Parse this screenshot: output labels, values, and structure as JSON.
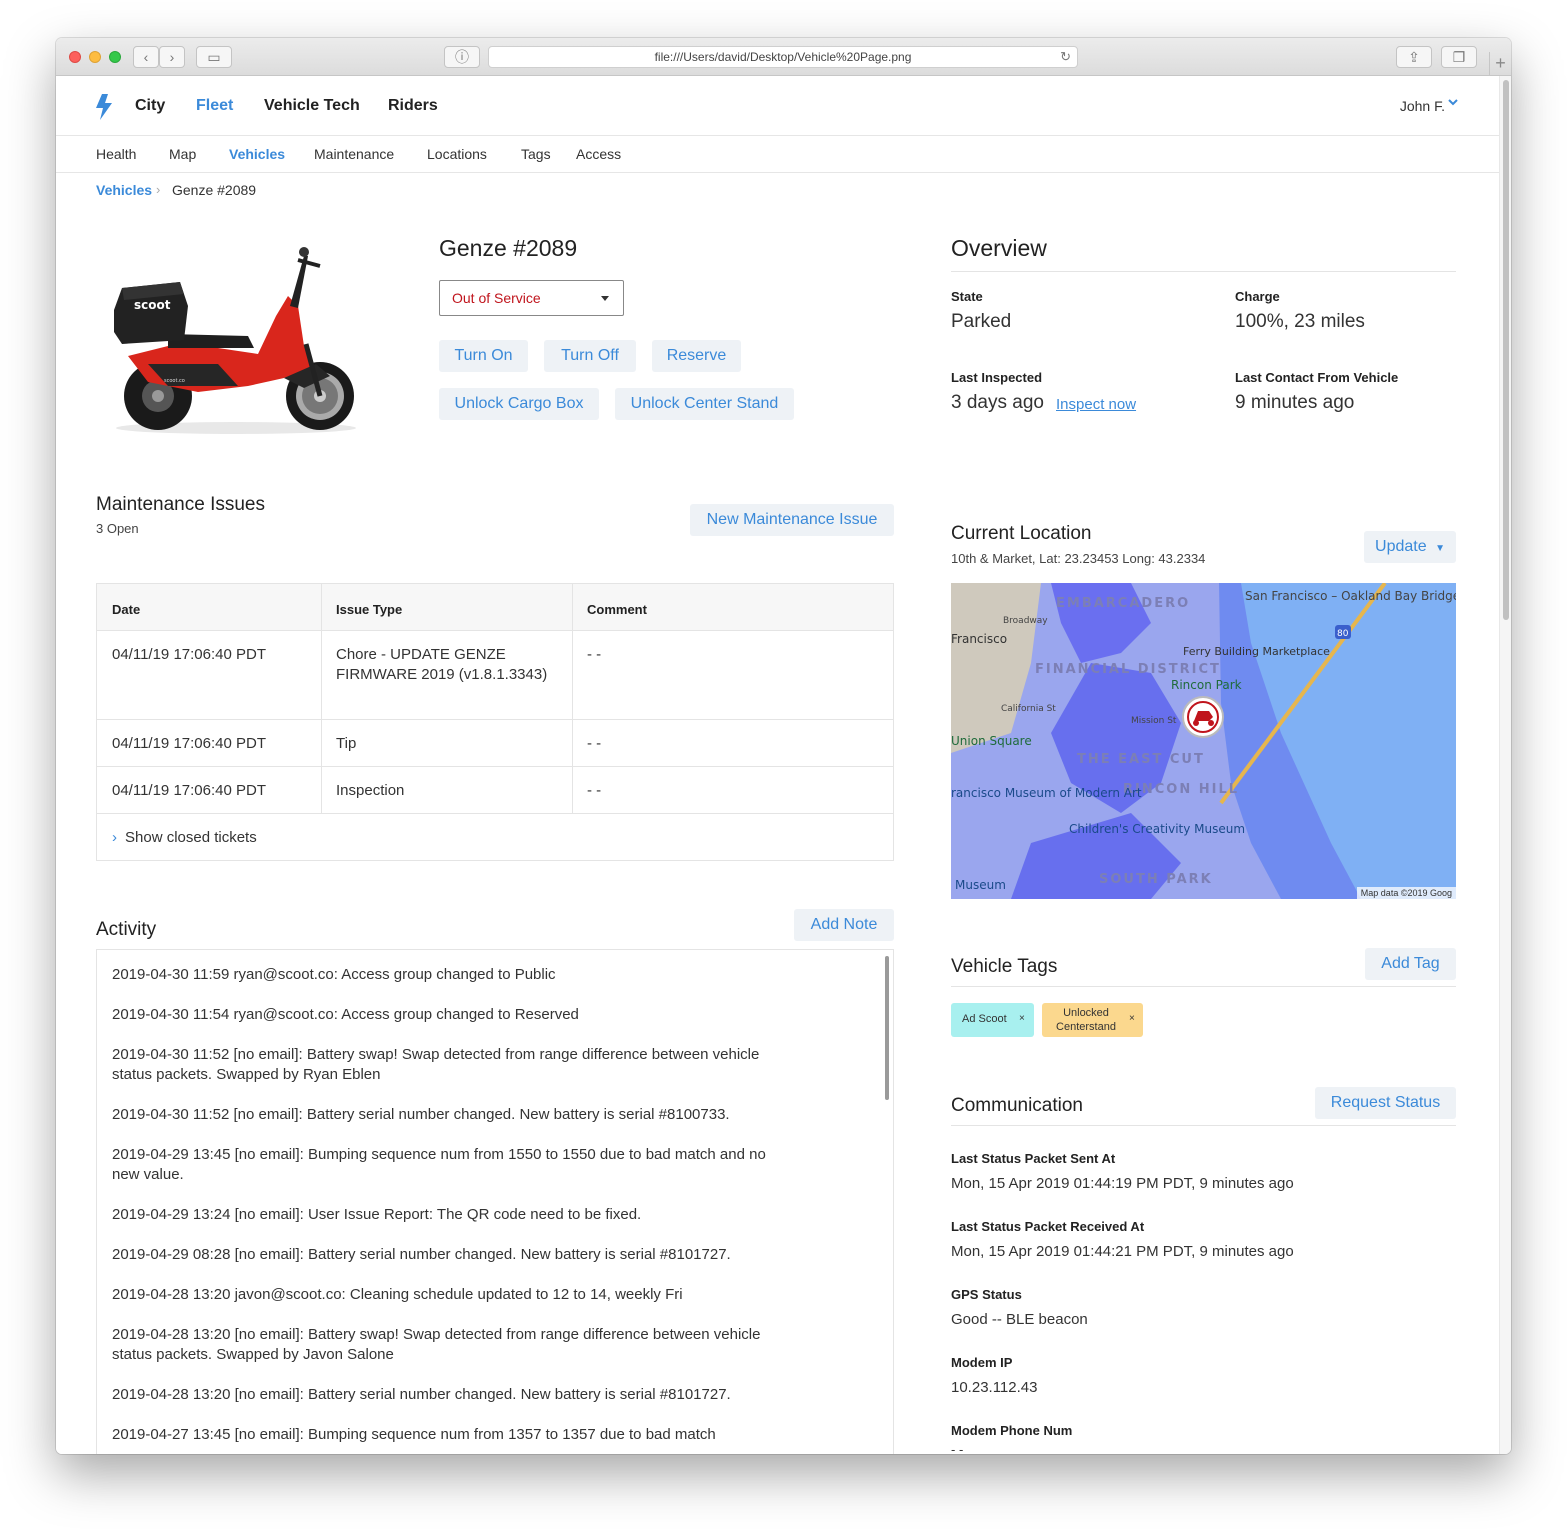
{
  "browser": {
    "url": "file:///Users/david/Desktop/Vehicle%20Page.png"
  },
  "topnav": {
    "items": [
      {
        "label": "City"
      },
      {
        "label": "Fleet"
      },
      {
        "label": "Vehicle Tech"
      },
      {
        "label": "Riders"
      }
    ],
    "active": "Fleet",
    "user": "John F."
  },
  "subnav": {
    "items": [
      {
        "label": "Health"
      },
      {
        "label": "Map"
      },
      {
        "label": "Vehicles"
      },
      {
        "label": "Maintenance"
      },
      {
        "label": "Locations"
      },
      {
        "label": "Tags"
      },
      {
        "label": "Access"
      }
    ],
    "active": "Vehicles"
  },
  "breadcrumb": {
    "parent": "Vehicles",
    "sep": "›",
    "current": "Genze #2089"
  },
  "vehicle": {
    "title": "Genze #2089",
    "status": "Out of Service",
    "scooter_brand": "scoot",
    "scooter_domain": "scoot.co",
    "actions": [
      {
        "label": "Turn On"
      },
      {
        "label": "Turn Off"
      },
      {
        "label": "Reserve"
      },
      {
        "label": "Unlock Cargo Box"
      },
      {
        "label": "Unlock Center Stand"
      }
    ]
  },
  "overview": {
    "title": "Overview",
    "state_label": "State",
    "state_value": "Parked",
    "charge_label": "Charge",
    "charge_value": "100%, 23 miles",
    "inspected_label": "Last Inspected",
    "inspected_value": "3 days ago",
    "inspect_link": "Inspect now",
    "contact_label": "Last Contact From Vehicle",
    "contact_value": "9 minutes ago"
  },
  "maintenance": {
    "title": "Maintenance Issues",
    "open_count": "3 Open",
    "new_button": "New Maintenance Issue",
    "columns": [
      "Date",
      "Issue Type",
      "Comment"
    ],
    "rows": [
      {
        "date": "04/11/19 17:06:40 PDT",
        "type": "Chore - UPDATE GENZE FIRMWARE 2019 (v1.8.1.3343)",
        "comment": "- -"
      },
      {
        "date": "04/11/19 17:06:40 PDT",
        "type": "Tip",
        "comment": "- -"
      },
      {
        "date": "04/11/19 17:06:40 PDT",
        "type": "Inspection",
        "comment": "- -"
      }
    ],
    "show_closed": "Show closed tickets"
  },
  "activity": {
    "title": "Activity",
    "add_button": "Add Note",
    "items": [
      "2019-04-30 11:59 ryan@scoot.co: Access group changed to Public",
      "2019-04-30 11:54 ryan@scoot.co: Access group changed to Reserved",
      "2019-04-30 11:52 [no email]: Battery swap! Swap detected from range difference between vehicle status packets. Swapped by Ryan Eblen",
      "2019-04-30 11:52 [no email]: Battery serial number changed. New battery is serial #8100733.",
      "2019-04-29 13:45 [no email]: Bumping sequence num from 1550 to 1550 due to bad match and no new value.",
      "2019-04-29 13:24 [no email]: User Issue Report: The QR code need to be fixed.",
      "2019-04-29 08:28 [no email]: Battery serial number changed. New battery is serial #8101727.",
      "2019-04-28 13:20 javon@scoot.co: Cleaning schedule updated to 12 to 14, weekly Fri",
      "2019-04-28 13:20 [no email]: Battery swap! Swap detected from range difference between vehicle status packets. Swapped by Javon Salone",
      "2019-04-28 13:20 [no email]: Battery serial number changed. New battery is serial #8101727.",
      "2019-04-27 13:45 [no email]: Bumping sequence num from 1357 to 1357 due to bad match"
    ]
  },
  "location": {
    "title": "Current Location",
    "subtitle": "10th & Market, Lat: 23.23453 Long: 43.2334",
    "update_button": "Update",
    "map_credit": "Map data ©2019 Goog",
    "map_labels": {
      "embarcadero": "EMBARCADERO",
      "bridge": "San Francisco – Oakland Bay Bridge",
      "broadway": "Broadway",
      "francisco": "Francisco",
      "ferry": "Ferry Building Marketplace",
      "financial": "FINANCIAL DISTRICT",
      "rincon_park": "Rincon Park",
      "california": "California St",
      "mission": "Mission St",
      "union": "Union Square",
      "east_cut": "THE EAST CUT",
      "rincon_hill": "RINCON HILL",
      "moma": "rancisco Museum of Modern Art",
      "childrens": "Children's Creativity Museum",
      "south_park": "SOUTH PARK",
      "museum": "Museum",
      "highway": "80"
    }
  },
  "tags": {
    "title": "Vehicle Tags",
    "add_button": "Add Tag",
    "items": [
      {
        "label": "Ad Scoot",
        "color": "#a8f0ef"
      },
      {
        "label": "Unlocked Centerstand",
        "color": "#fbd88e"
      }
    ],
    "remove_glyph": "×"
  },
  "communication": {
    "title": "Communication",
    "request_button": "Request Status",
    "fields": [
      {
        "label": "Last Status Packet Sent At",
        "value": "Mon, 15 Apr 2019 01:44:19 PM PDT, 9 minutes ago"
      },
      {
        "label": "Last Status Packet Received At",
        "value": "Mon, 15 Apr 2019 01:44:21 PM PDT, 9 minutes ago"
      },
      {
        "label": "GPS Status",
        "value": "Good -- BLE beacon"
      },
      {
        "label": "Modem IP",
        "value": "10.23.112.43"
      },
      {
        "label": "Modem Phone Num",
        "value": "- -"
      }
    ]
  },
  "colors": {
    "accent": "#3b8ad9",
    "status_red": "#c0141c",
    "button_bg": "#eef2f6"
  },
  "icons": [
    "bolt-logo-icon",
    "chevron-down-icon",
    "chevron-right-icon",
    "caret-down-icon",
    "close-icon",
    "scooter-marker-icon"
  ]
}
